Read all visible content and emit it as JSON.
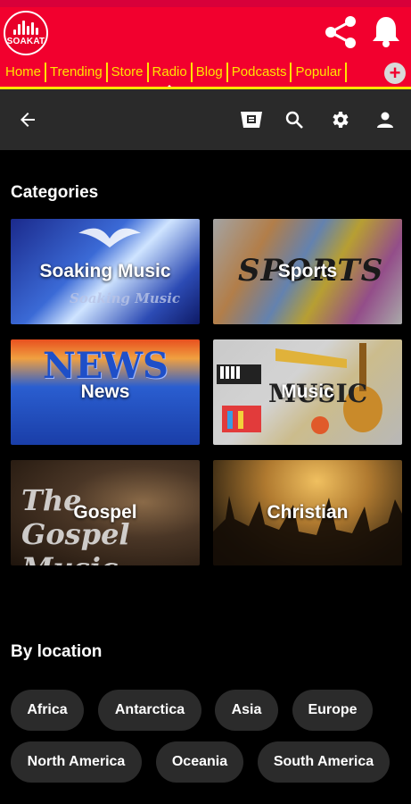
{
  "brand": {
    "logo_text": "SOAKAT"
  },
  "nav": {
    "items": [
      "Home",
      "Trending",
      "Store",
      "Radio",
      "Blog",
      "Podcasts",
      "Popular"
    ],
    "active": "Radio"
  },
  "sections": {
    "categories_title": "Categories",
    "location_title": "By location"
  },
  "categories": [
    {
      "label": "Soaking Music",
      "deco": "Soaking Music"
    },
    {
      "label": "Sports",
      "deco": "SPORTS"
    },
    {
      "label": "News",
      "deco": "NEWS"
    },
    {
      "label": "Music",
      "deco": "MUSIC"
    },
    {
      "label": "Gospel",
      "deco": "The Gospel Music"
    },
    {
      "label": "Christian",
      "deco": ""
    }
  ],
  "locations": [
    "Africa",
    "Antarctica",
    "Asia",
    "Europe",
    "North America",
    "Oceania",
    "South America"
  ],
  "colors": {
    "brand_red": "#f2002e",
    "nav_yellow": "#ffe400",
    "toolbar": "#2a2a2a",
    "chip": "#2b2b2b"
  }
}
